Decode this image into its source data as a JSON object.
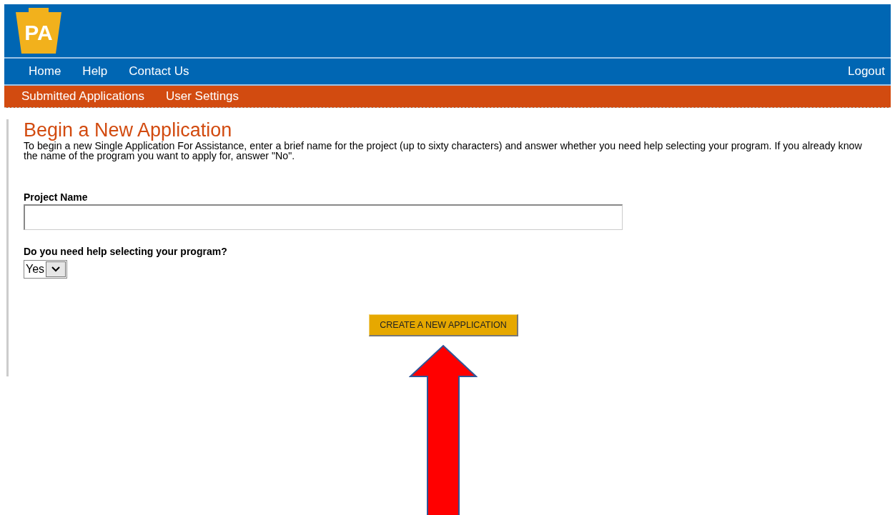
{
  "header": {
    "logo_text": "PA"
  },
  "nav": {
    "items": [
      {
        "label": "Home"
      },
      {
        "label": "Help"
      },
      {
        "label": "Contact Us"
      }
    ],
    "logout": "Logout"
  },
  "subnav": {
    "items": [
      {
        "label": "Submitted Applications"
      },
      {
        "label": "User Settings"
      }
    ]
  },
  "page": {
    "title": "Begin a New Application",
    "intro": "To begin a new Single Application For Assistance, enter a brief name for the project (up to sixty characters) and answer whether you need help selecting your program. If you already know the name of the program you want to apply for, answer \"No\".",
    "project_name": {
      "label": "Project Name"
    },
    "help_select": {
      "label": "Do you need help selecting your program?",
      "value": "Yes"
    },
    "submit": "CREATE A NEW APPLICATION"
  },
  "annotation": {
    "kind": "arrow"
  }
}
